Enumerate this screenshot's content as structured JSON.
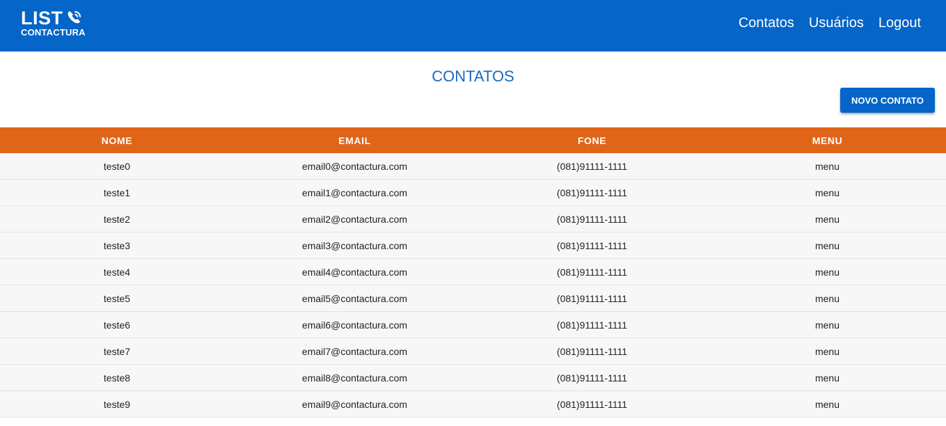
{
  "header": {
    "logo_main": "LIST",
    "logo_sub": "CONTACTURA",
    "logo_icon": "phone-icon",
    "nav": [
      "Contatos",
      "Usuários",
      "Logout"
    ]
  },
  "main": {
    "title": "CONTATOS",
    "new_button_label": "NOVO CONTATO"
  },
  "table": {
    "headers": [
      "NOME",
      "EMAIL",
      "FONE",
      "MENU"
    ],
    "rows": [
      [
        "teste0",
        "email0@contactura.com",
        "(081)91111-1111",
        "menu"
      ],
      [
        "teste1",
        "email1@contactura.com",
        "(081)91111-1111",
        "menu"
      ],
      [
        "teste2",
        "email2@contactura.com",
        "(081)91111-1111",
        "menu"
      ],
      [
        "teste3",
        "email3@contactura.com",
        "(081)91111-1111",
        "menu"
      ],
      [
        "teste4",
        "email4@contactura.com",
        "(081)91111-1111",
        "menu"
      ],
      [
        "teste5",
        "email5@contactura.com",
        "(081)91111-1111",
        "menu"
      ],
      [
        "teste6",
        "email6@contactura.com",
        "(081)91111-1111",
        "menu"
      ],
      [
        "teste7",
        "email7@contactura.com",
        "(081)91111-1111",
        "menu"
      ],
      [
        "teste8",
        "email8@contactura.com",
        "(081)91111-1111",
        "menu"
      ],
      [
        "teste9",
        "email9@contactura.com",
        "(081)91111-1111",
        "menu"
      ]
    ]
  },
  "colors": {
    "primary": "#0565c8",
    "table_header": "#e16518",
    "title": "#1a68c0",
    "row_bg": "#f7f7f7"
  }
}
